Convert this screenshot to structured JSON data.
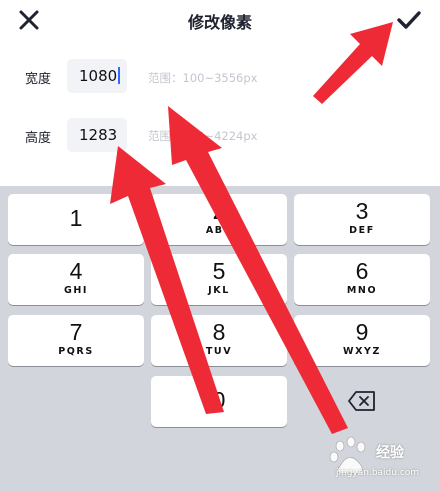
{
  "header": {
    "title": "修改像素",
    "close_icon": "close-icon",
    "confirm_icon": "checkmark-icon"
  },
  "width_row": {
    "label": "宽度",
    "value": "1080",
    "hint": "范围：100~3556px"
  },
  "height_row": {
    "label": "高度",
    "value": "1283",
    "hint": "范围：100~4224px"
  },
  "keypad": {
    "keys": [
      {
        "num": "1",
        "letters": ""
      },
      {
        "num": "2",
        "letters": "ABC"
      },
      {
        "num": "3",
        "letters": "DEF"
      },
      {
        "num": "4",
        "letters": "GHI"
      },
      {
        "num": "5",
        "letters": "JKL"
      },
      {
        "num": "6",
        "letters": "MNO"
      },
      {
        "num": "7",
        "letters": "PQRS"
      },
      {
        "num": "8",
        "letters": "TUV"
      },
      {
        "num": "9",
        "letters": "WXYZ"
      },
      {
        "num": "0",
        "letters": ""
      }
    ],
    "backspace_icon": "backspace-icon"
  },
  "watermark": {
    "text": "经验",
    "sub": "jingyan.baidu.com"
  },
  "colors": {
    "annotation_arrow": "#ee2a36",
    "caret": "#2f6bff",
    "keyboard_bg": "#d2d5db"
  }
}
